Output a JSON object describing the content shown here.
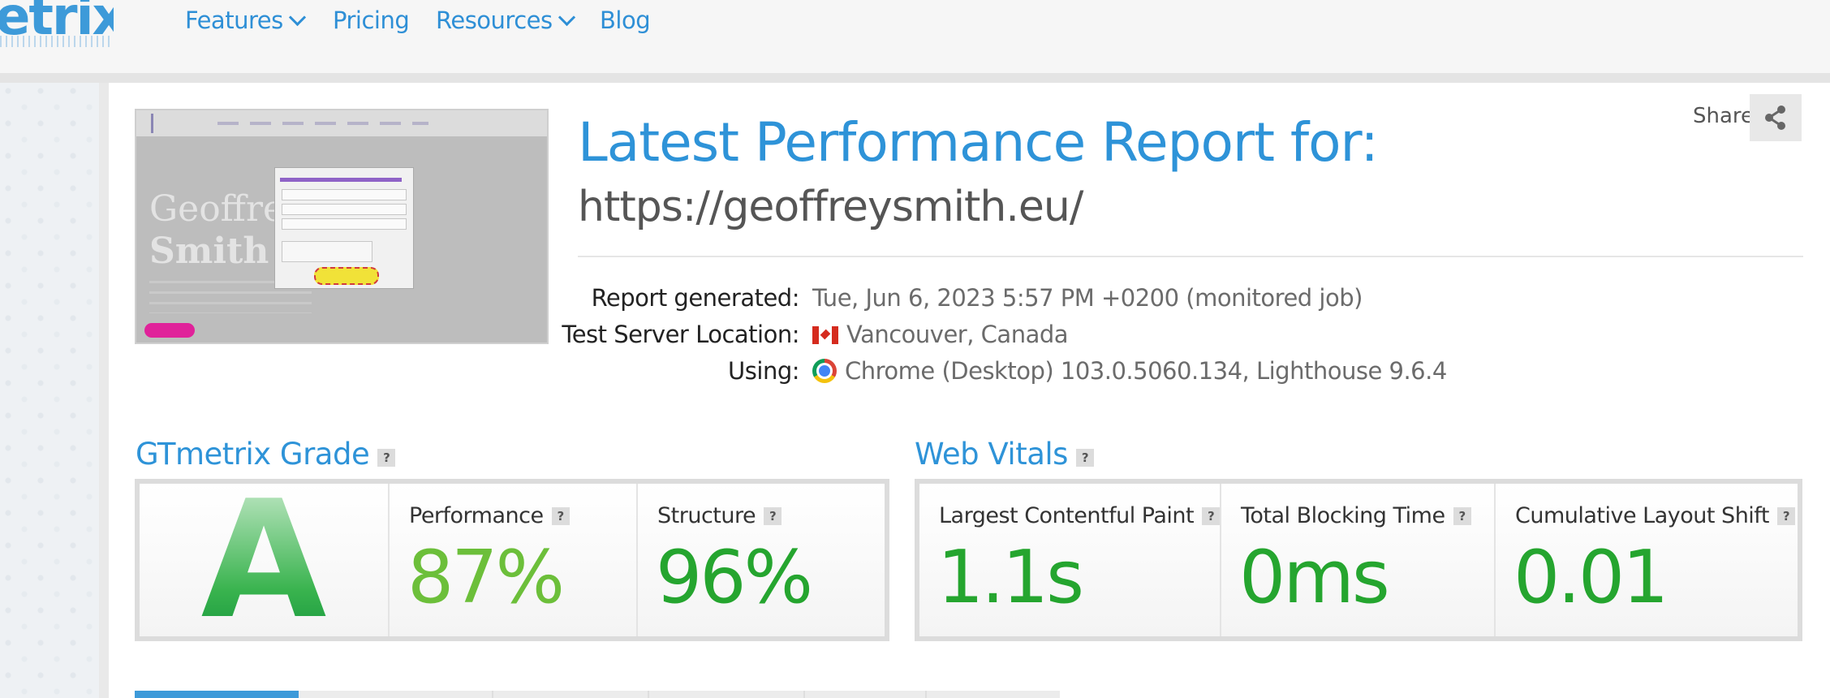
{
  "header": {
    "logo_text": "etrix",
    "nav": [
      {
        "label": "Features",
        "has_dropdown": true
      },
      {
        "label": "Pricing",
        "has_dropdown": false
      },
      {
        "label": "Resources",
        "has_dropdown": true
      },
      {
        "label": "Blog",
        "has_dropdown": false
      }
    ]
  },
  "report": {
    "title": "Latest Performance Report for:",
    "url": "https://geoffreysmith.eu/",
    "share_label": "Share",
    "meta": {
      "generated_label": "Report generated:",
      "generated_value": "Tue, Jun 6, 2023 5:57 PM +0200 (monitored job)",
      "location_label": "Test Server Location:",
      "location_value": "Vancouver, Canada",
      "using_label": "Using:",
      "using_value": "Chrome (Desktop) 103.0.5060.134, Lighthouse 9.6.4"
    }
  },
  "thumbnail": {
    "site_name_line1": "Geoffre",
    "site_name_line2": "Smith"
  },
  "grade": {
    "title": "GTmetrix Grade",
    "help": "?",
    "letter": "A",
    "performance_label": "Performance",
    "performance_value": "87%",
    "structure_label": "Structure",
    "structure_value": "96%"
  },
  "vitals": {
    "title": "Web Vitals",
    "help": "?",
    "lcp_label": "Largest Contentful Paint",
    "lcp_value": "1.1s",
    "tbt_label": "Total Blocking Time",
    "tbt_value": "0ms",
    "cls_label": "Cumulative Layout Shift",
    "cls_value": "0.01"
  },
  "colors": {
    "brand_blue": "#2e93d8",
    "grade_green": "#1fa34a",
    "performance_green": "#6cbf3a",
    "good_green": "#25a52f"
  }
}
